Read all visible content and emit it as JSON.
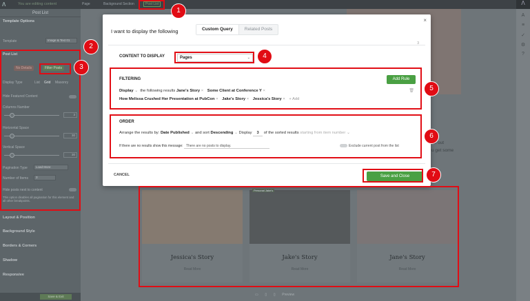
{
  "topbar": {
    "status": "You are editing content",
    "crumbs": [
      "Page",
      "Background Section",
      "Post List"
    ]
  },
  "sidebar": {
    "title": "Post List",
    "template_options": "Template Options",
    "template_label": "Template",
    "template_value": "Image & Text 01",
    "post_list": "Post List",
    "tab_no_details": "No Details",
    "tab_filter_posts": "Filter Posts",
    "display_type_label": "Display Type",
    "display_type_options": [
      "List",
      "Grid",
      "Masonry"
    ],
    "hide_featured": "Hide Featured Content",
    "columns_number": "Columns Number",
    "columns_value": "3",
    "horizontal_space": "Horizontal Space",
    "horizontal_value": "30",
    "vertical_space": "Vertical Space",
    "vertical_value": "30",
    "pagination_type": "Pagination Type",
    "pagination_value": "Load More",
    "number_of_items": "Number of Items",
    "number_value": "3",
    "hide_after": "Hide posts next to content",
    "note": "This option disables all pagination for this element and all other breakpoints.",
    "layout_position": "Layout & Position",
    "background_style": "Background Style",
    "borders_corners": "Borders & Corners",
    "shadow": "Shadow",
    "responsive": "Responsive",
    "save_label": "Save & Exit"
  },
  "page": {
    "side_text": [
      "ab out",
      "u get some"
    ],
    "cards": [
      {
        "name": "Jessica's Story",
        "read_more": "Read More",
        "color": "#857a70"
      },
      {
        "name": "Jake's Story",
        "read_more": "Read More",
        "color": "#55595b",
        "tag": "Personal Jake's"
      },
      {
        "name": "Jane's Story",
        "read_more": "Read More",
        "color": "#7b7576"
      }
    ],
    "bottom_icons": [
      "desktop-icon",
      "tablet-icon",
      "mobile-icon"
    ],
    "preview": "Preview"
  },
  "modal": {
    "heading": "I want to display the following",
    "tabs": [
      "Custom Query",
      "Related Posts"
    ],
    "page_number": "3",
    "content_label": "CONTENT TO DISPLAY",
    "content_value": "Pages",
    "filter": {
      "label": "FILTERING",
      "add_rule": "Add Rule",
      "display": "Display",
      "results_text": "the following results",
      "tags_line1": [
        "Jane's Story",
        "Some Client at Conference Y"
      ],
      "tags_line2": [
        "How Melissa Crushed Her Presentation at PubCon",
        "Jake's Story",
        "Jessica's Story"
      ],
      "add": "+ Add"
    },
    "order": {
      "label": "ORDER",
      "arrange": "Arrange the results by:",
      "sort_field": "Date Published",
      "and_sort": "and sort",
      "direction": "Descending",
      "display": "Display",
      "count": "3",
      "of_sorted": "of the sorted results",
      "start_placeholder": "starting from item number",
      "no_results_label": "If there are no results show this message:",
      "no_results_value": "There are no posts to display.",
      "exclude_label": "Exclude current post from the list"
    },
    "cancel": "CANCEL",
    "save": "Save and Close"
  },
  "badges": [
    "1",
    "2",
    "3",
    "4",
    "5",
    "6",
    "7"
  ],
  "colors": {
    "annotation_red": "#e10c14",
    "accent_green": "#4aa043"
  }
}
